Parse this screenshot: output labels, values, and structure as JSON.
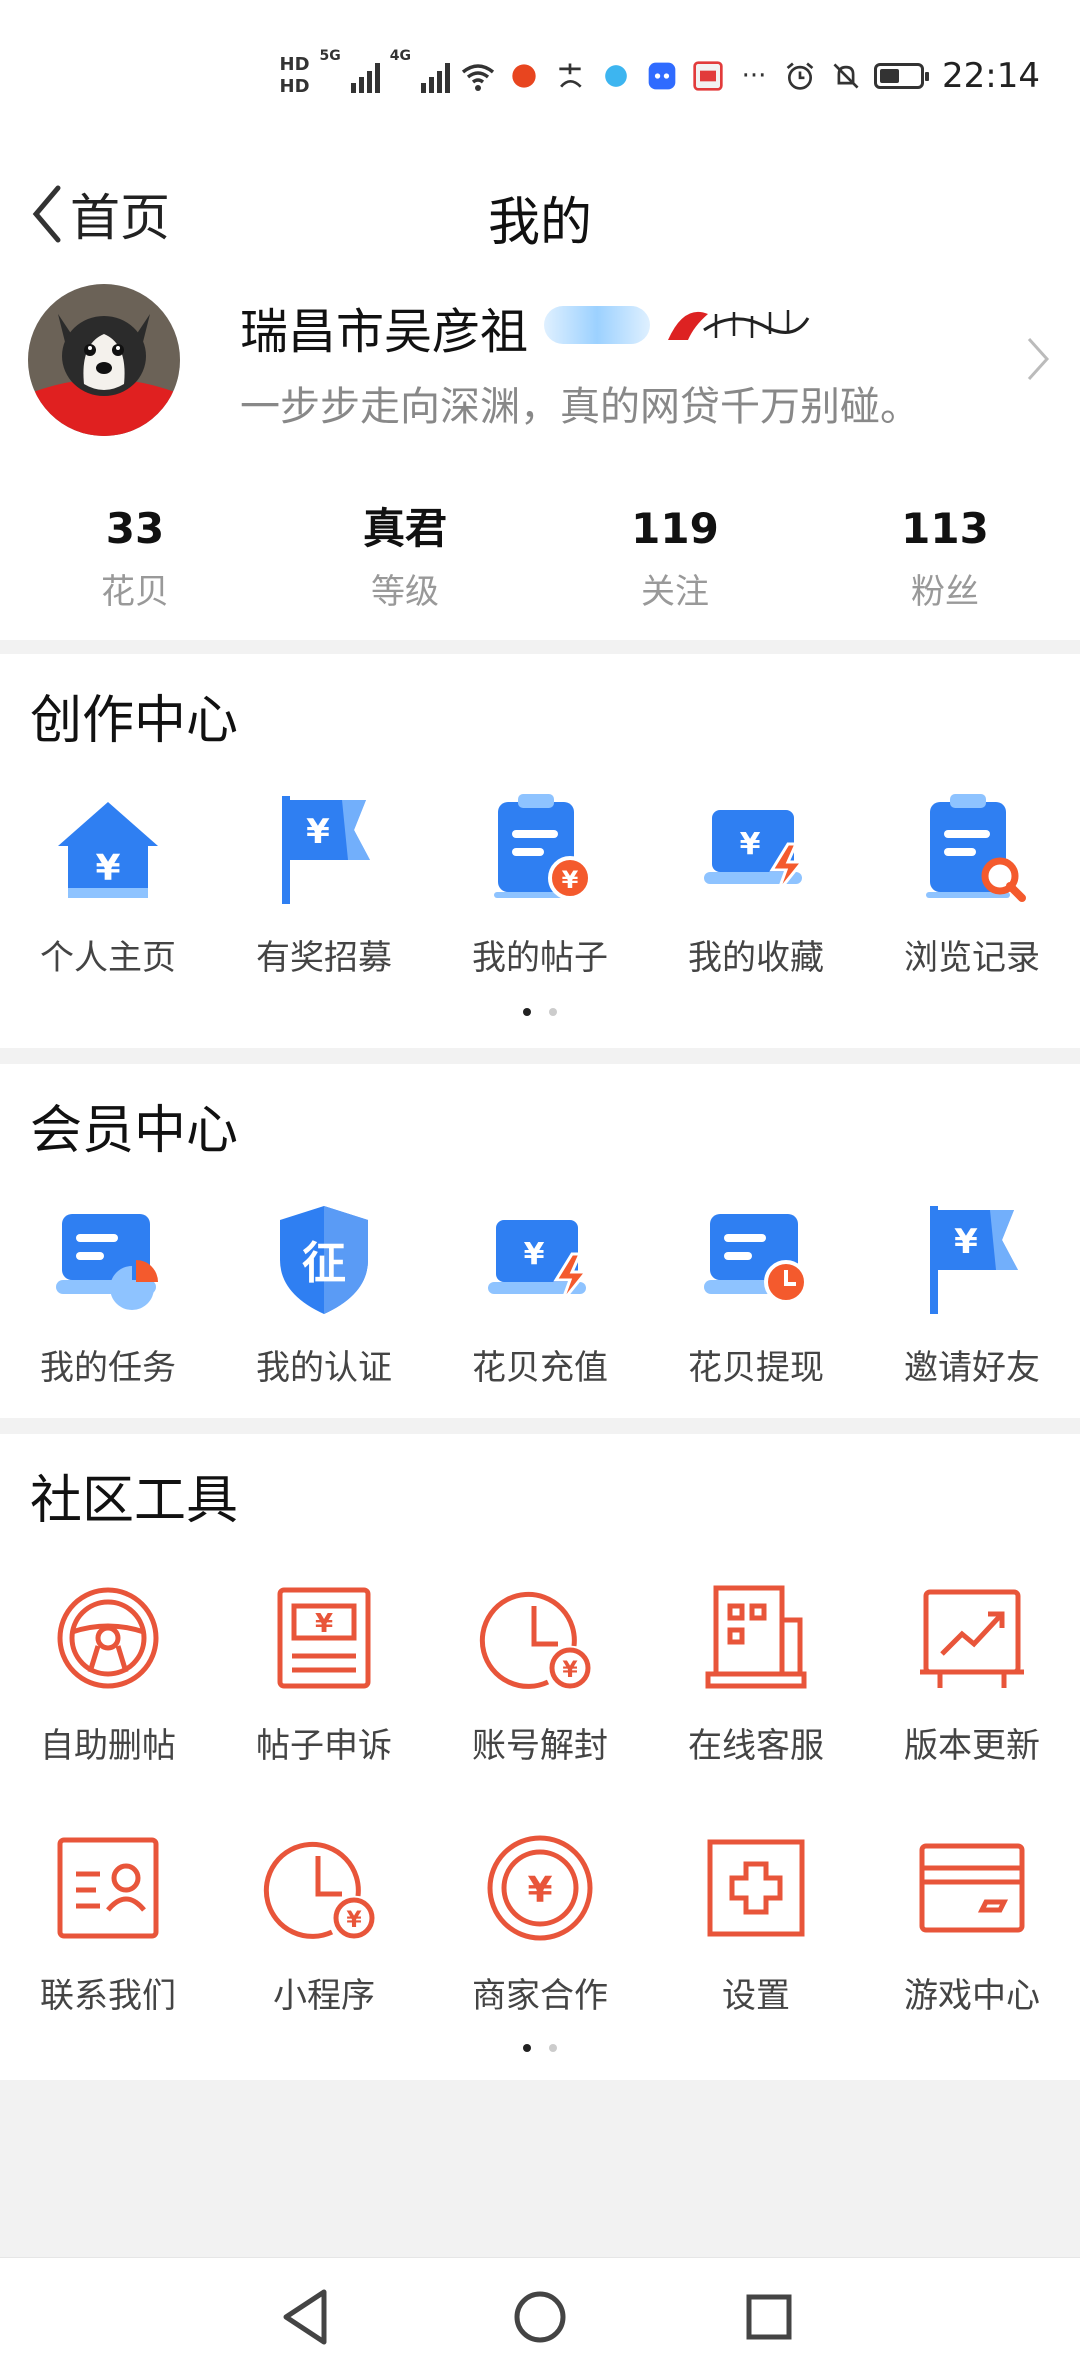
{
  "status_bar": {
    "hd1": "HD",
    "hd2": "HD",
    "net1": "5G",
    "net2": "4G",
    "battery_level": 0.5,
    "time": "22:14",
    "overflow": "···"
  },
  "nav": {
    "back_label": "首页",
    "title": "我的"
  },
  "profile": {
    "username": "瑞昌市吴彦祖",
    "bio": "一步步走向深渊，真的网贷千万别碰。",
    "stats": [
      {
        "value": "33",
        "label": "花贝"
      },
      {
        "value": "真君",
        "label": "等级"
      },
      {
        "value": "119",
        "label": "关注"
      },
      {
        "value": "113",
        "label": "粉丝"
      }
    ]
  },
  "creation_center": {
    "title": "创作中心",
    "items": [
      {
        "label": "个人主页",
        "icon": "home-yen-icon"
      },
      {
        "label": "有奖招募",
        "icon": "flag-yen-icon"
      },
      {
        "label": "我的帖子",
        "icon": "clipboard-yen-icon"
      },
      {
        "label": "我的收藏",
        "icon": "monitor-yen-bolt-icon"
      },
      {
        "label": "浏览记录",
        "icon": "clipboard-search-icon"
      }
    ],
    "page_index": 0,
    "page_count": 2
  },
  "member_center": {
    "title": "会员中心",
    "items": [
      {
        "label": "我的任务",
        "icon": "task-chart-icon"
      },
      {
        "label": "我的认证",
        "icon": "shield-certify-icon"
      },
      {
        "label": "花贝充值",
        "icon": "monitor-yen-bolt-icon"
      },
      {
        "label": "花贝提现",
        "icon": "card-clock-icon"
      },
      {
        "label": "邀请好友",
        "icon": "flag-yen-icon"
      }
    ]
  },
  "community_tools": {
    "title": "社区工具",
    "rows": [
      [
        {
          "label": "自助删帖",
          "icon": "steering-wheel-icon"
        },
        {
          "label": "帖子申诉",
          "icon": "banknote-icon"
        },
        {
          "label": "账号解封",
          "icon": "clock-yen-icon"
        },
        {
          "label": "在线客服",
          "icon": "building-icon"
        },
        {
          "label": "版本更新",
          "icon": "trend-chart-icon"
        }
      ],
      [
        {
          "label": "联系我们",
          "icon": "contact-card-icon"
        },
        {
          "label": "小程序",
          "icon": "clock-yen-icon"
        },
        {
          "label": "商家合作",
          "icon": "coin-icon"
        },
        {
          "label": "设置",
          "icon": "plus-box-icon"
        },
        {
          "label": "游戏中心",
          "icon": "card-icon"
        }
      ]
    ],
    "page_index": 0,
    "page_count": 2
  },
  "colors": {
    "blue": "#2f7ff2",
    "blue_light": "#8ec3ff",
    "orange": "#f45a2d",
    "tool_red": "#e8553a"
  }
}
